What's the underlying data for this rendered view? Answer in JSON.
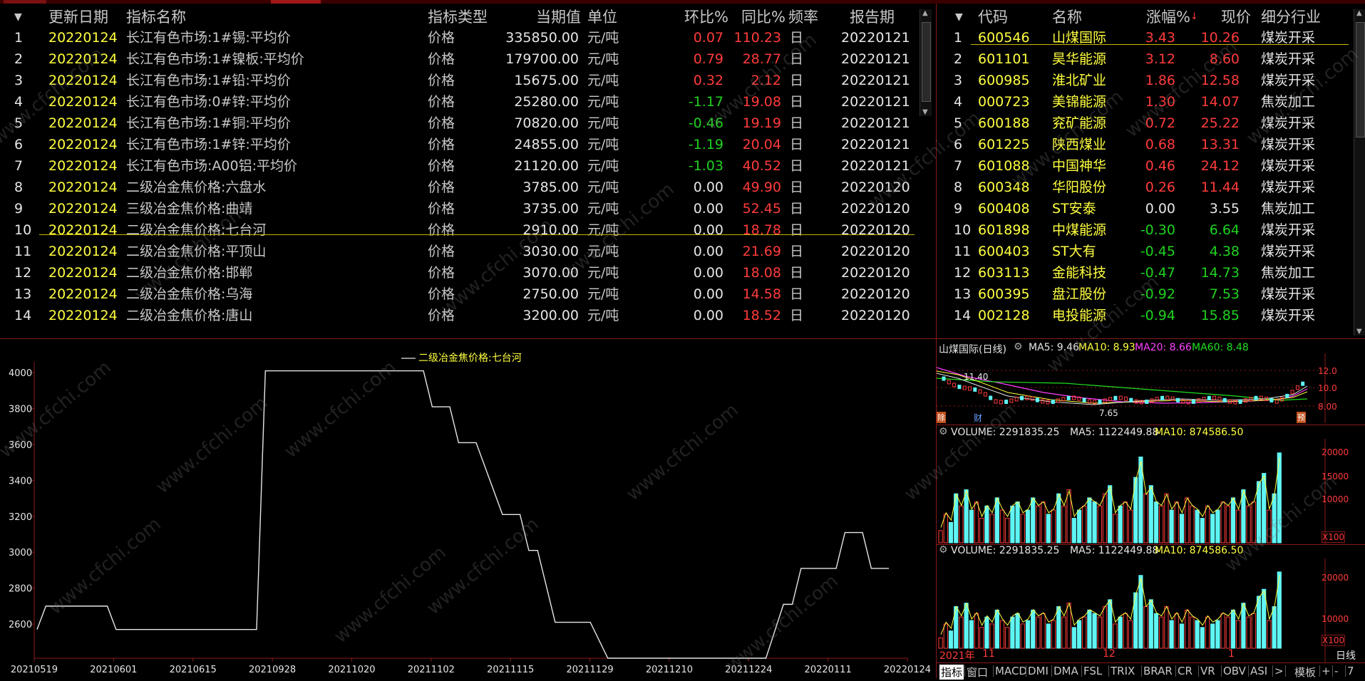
{
  "left_table": {
    "sort_icon": "sort-triangle",
    "headers": {
      "date": "更新日期",
      "name": "指标名称",
      "type": "指标类型",
      "value": "当期值",
      "unit": "单位",
      "mom": "环比%",
      "yoy": "同比%",
      "freq": "频率",
      "period": "报告期"
    },
    "rows": [
      {
        "no": "1",
        "date": "20220124",
        "name": "长江有色市场:1#锡:平均价",
        "type": "价格",
        "value": "335850.00",
        "unit": "元/吨",
        "mom": "0.07",
        "yoy": "110.23",
        "freq": "日",
        "period": "20220121",
        "mom_color": "red"
      },
      {
        "no": "2",
        "date": "20220124",
        "name": "长江有色市场:1#镍板:平均价",
        "type": "价格",
        "value": "179700.00",
        "unit": "元/吨",
        "mom": "0.79",
        "yoy": "28.77",
        "freq": "日",
        "period": "20220121",
        "mom_color": "red"
      },
      {
        "no": "3",
        "date": "20220124",
        "name": "长江有色市场:1#铅:平均价",
        "type": "价格",
        "value": "15675.00",
        "unit": "元/吨",
        "mom": "0.32",
        "yoy": "2.12",
        "freq": "日",
        "period": "20220121",
        "mom_color": "red"
      },
      {
        "no": "4",
        "date": "20220124",
        "name": "长江有色市场:0#锌:平均价",
        "type": "价格",
        "value": "25280.00",
        "unit": "元/吨",
        "mom": "-1.17",
        "yoy": "19.08",
        "freq": "日",
        "period": "20220121",
        "mom_color": "green"
      },
      {
        "no": "5",
        "date": "20220124",
        "name": "长江有色市场:1#铜:平均价",
        "type": "价格",
        "value": "70820.00",
        "unit": "元/吨",
        "mom": "-0.46",
        "yoy": "19.19",
        "freq": "日",
        "period": "20220121",
        "mom_color": "green"
      },
      {
        "no": "6",
        "date": "20220124",
        "name": "长江有色市场:1#锌:平均价",
        "type": "价格",
        "value": "24855.00",
        "unit": "元/吨",
        "mom": "-1.19",
        "yoy": "20.04",
        "freq": "日",
        "period": "20220121",
        "mom_color": "green"
      },
      {
        "no": "7",
        "date": "20220124",
        "name": "长江有色市场:A00铝:平均价",
        "type": "价格",
        "value": "21120.00",
        "unit": "元/吨",
        "mom": "-1.03",
        "yoy": "40.52",
        "freq": "日",
        "period": "20220121",
        "mom_color": "green"
      },
      {
        "no": "8",
        "date": "20220124",
        "name": "二级冶金焦价格:六盘水",
        "type": "价格",
        "value": "3785.00",
        "unit": "元/吨",
        "mom": "0.00",
        "yoy": "49.90",
        "freq": "日",
        "period": "20220120",
        "mom_color": "white"
      },
      {
        "no": "9",
        "date": "20220124",
        "name": "三级冶金焦价格:曲靖",
        "type": "价格",
        "value": "3735.00",
        "unit": "元/吨",
        "mom": "0.00",
        "yoy": "52.45",
        "freq": "日",
        "period": "20220120",
        "mom_color": "white"
      },
      {
        "no": "10",
        "date": "20220124",
        "name": "二级冶金焦价格:七台河",
        "type": "价格",
        "value": "2910.00",
        "unit": "元/吨",
        "mom": "0.00",
        "yoy": "18.78",
        "freq": "日",
        "period": "20220120",
        "mom_color": "white"
      },
      {
        "no": "11",
        "date": "20220124",
        "name": "二级冶金焦价格:平顶山",
        "type": "价格",
        "value": "3030.00",
        "unit": "元/吨",
        "mom": "0.00",
        "yoy": "21.69",
        "freq": "日",
        "period": "20220120",
        "mom_color": "white"
      },
      {
        "no": "12",
        "date": "20220124",
        "name": "二级冶金焦价格:邯郸",
        "type": "价格",
        "value": "3070.00",
        "unit": "元/吨",
        "mom": "0.00",
        "yoy": "18.08",
        "freq": "日",
        "period": "20220120",
        "mom_color": "white"
      },
      {
        "no": "13",
        "date": "20220124",
        "name": "二级冶金焦价格:乌海",
        "type": "价格",
        "value": "2750.00",
        "unit": "元/吨",
        "mom": "0.00",
        "yoy": "14.58",
        "freq": "日",
        "period": "20220120",
        "mom_color": "white"
      },
      {
        "no": "14",
        "date": "20220124",
        "name": "二级冶金焦价格:唐山",
        "type": "价格",
        "value": "3200.00",
        "unit": "元/吨",
        "mom": "0.00",
        "yoy": "18.52",
        "freq": "日",
        "period": "20220120",
        "mom_color": "white"
      }
    ]
  },
  "right_table": {
    "headers": {
      "code": "代码",
      "name": "名称",
      "chg": "涨幅%",
      "price": "现价",
      "industry": "细分行业"
    },
    "rows": [
      {
        "no": "1",
        "code": "600546",
        "name": "山煤国际",
        "chg": "3.43",
        "price": "10.26",
        "industry": "煤炭开采",
        "c": "red"
      },
      {
        "no": "2",
        "code": "601101",
        "name": "昊华能源",
        "chg": "3.12",
        "price": "8.60",
        "industry": "煤炭开采",
        "c": "red"
      },
      {
        "no": "3",
        "code": "600985",
        "name": "淮北矿业",
        "chg": "1.86",
        "price": "12.58",
        "industry": "煤炭开采",
        "c": "red"
      },
      {
        "no": "4",
        "code": "000723",
        "name": "美锦能源",
        "chg": "1.30",
        "price": "14.07",
        "industry": "焦炭加工",
        "c": "red"
      },
      {
        "no": "5",
        "code": "600188",
        "name": "兖矿能源",
        "chg": "0.72",
        "price": "25.22",
        "industry": "煤炭开采",
        "c": "red"
      },
      {
        "no": "6",
        "code": "601225",
        "name": "陕西煤业",
        "chg": "0.68",
        "price": "13.31",
        "industry": "煤炭开采",
        "c": "red"
      },
      {
        "no": "7",
        "code": "601088",
        "name": "中国神华",
        "chg": "0.46",
        "price": "24.12",
        "industry": "煤炭开采",
        "c": "red"
      },
      {
        "no": "8",
        "code": "600348",
        "name": "华阳股份",
        "chg": "0.26",
        "price": "11.44",
        "industry": "煤炭开采",
        "c": "red"
      },
      {
        "no": "9",
        "code": "600408",
        "name": "ST安泰",
        "chg": "0.00",
        "price": "3.55",
        "industry": "焦炭加工",
        "c": "white"
      },
      {
        "no": "10",
        "code": "601898",
        "name": "中煤能源",
        "chg": "-0.30",
        "price": "6.64",
        "industry": "煤炭开采",
        "c": "green"
      },
      {
        "no": "11",
        "code": "600403",
        "name": "ST大有",
        "chg": "-0.45",
        "price": "4.38",
        "industry": "煤炭开采",
        "c": "green"
      },
      {
        "no": "12",
        "code": "603113",
        "name": "金能科技",
        "chg": "-0.47",
        "price": "14.73",
        "industry": "焦炭加工",
        "c": "green"
      },
      {
        "no": "13",
        "code": "600395",
        "name": "盘江股份",
        "chg": "-0.92",
        "price": "7.53",
        "industry": "煤炭开采",
        "c": "green"
      },
      {
        "no": "14",
        "code": "002128",
        "name": "电投能源",
        "chg": "-0.94",
        "price": "15.85",
        "industry": "煤炭开采",
        "c": "green"
      }
    ]
  },
  "kline": {
    "title": "山煤国际(日线)",
    "ma5": "MA5: 9.46",
    "ma10": "MA10: 8.93",
    "ma20": "MA20: 8.66",
    "ma60": "MA60: 8.48",
    "high_label": "11.40",
    "low_label": "7.65",
    "yticks": [
      "12.0",
      "10.0",
      "8.00"
    ],
    "left_badge": "除",
    "cai_badge": "财",
    "yu_badge": "预"
  },
  "vol1": {
    "label": "VOLUME: 2291835.25",
    "ma5": "MA5: 1122449.88",
    "ma10": "MA10: 874586.50",
    "yticks": [
      "20000",
      "15000",
      "10000"
    ],
    "unit": "X100"
  },
  "vol2": {
    "label": "VOLUME: 2291835.25",
    "ma5": "MA5: 1122449.88",
    "ma10": "MA10: 874586.50",
    "yticks": [
      "20000",
      "10000"
    ],
    "unit": "X100"
  },
  "vol_xaxis": {
    "labels": [
      "2021年",
      "11",
      "12",
      "1"
    ],
    "right": "日线"
  },
  "tabs": [
    "指标",
    "窗口",
    "MACD",
    "DMI",
    "DMA",
    "FSL",
    "TRIX",
    "BRAR",
    "CR",
    "VR",
    "OBV",
    "ASI",
    ">",
    "模板",
    "+",
    "-",
    "7"
  ],
  "watermark": "www.cfchi.com",
  "colors": {
    "up": "#ff3b3b",
    "down": "#1fd21f",
    "yellow": "#ffff40",
    "line": "#e6e6e6",
    "grid_red": "#8a1a1a",
    "vol_cyan": "#5ff5f5"
  },
  "chart_data": {
    "type": "line",
    "title": "",
    "series": [
      {
        "name": "二级冶金焦价格:七台河",
        "x": [
          "20210519",
          "20210601",
          "20210615",
          "20210928",
          "20211020",
          "20211102",
          "20211115",
          "20211129",
          "20211210",
          "20211224",
          "20220111",
          "20220124"
        ],
        "values": [
          2570,
          2700,
          2570,
          2570,
          4010,
          4010,
          3810,
          3010,
          2410,
          2410,
          2910,
          2910
        ]
      }
    ],
    "xlabel": "",
    "ylabel": "",
    "yticks": [
      2600,
      2800,
      3000,
      3200,
      3400,
      3600,
      3800,
      4000
    ],
    "ylim": [
      2410,
      4060
    ],
    "legend": "top-center",
    "profile": [
      [
        0,
        2570
      ],
      [
        1,
        2700
      ],
      [
        8,
        2700
      ],
      [
        9,
        2570
      ],
      [
        25,
        2570
      ],
      [
        26,
        4010
      ],
      [
        44,
        4010
      ],
      [
        45,
        3810
      ],
      [
        47,
        3810
      ],
      [
        48,
        3610
      ],
      [
        50,
        3610
      ],
      [
        53,
        3210
      ],
      [
        55,
        3210
      ],
      [
        56,
        3010
      ],
      [
        57,
        3010
      ],
      [
        59,
        2610
      ],
      [
        63,
        2610
      ],
      [
        65,
        2410
      ],
      [
        83,
        2410
      ],
      [
        85,
        2710
      ],
      [
        86,
        2710
      ],
      [
        87,
        2910
      ],
      [
        91,
        2910
      ],
      [
        92,
        3110
      ],
      [
        94,
        3110
      ],
      [
        95,
        2910
      ],
      [
        97,
        2910
      ]
    ]
  }
}
